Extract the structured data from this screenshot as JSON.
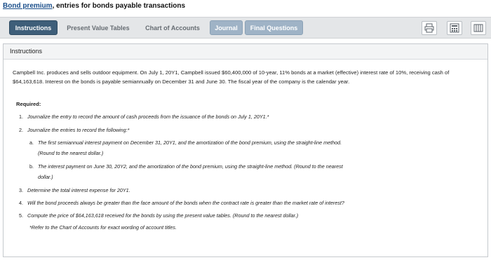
{
  "header": {
    "title_link": "Bond premium",
    "title_rest": ", entries for bonds payable transactions"
  },
  "tabs": [
    {
      "label": "Instructions"
    },
    {
      "label": "Present Value Tables"
    },
    {
      "label": "Chart of Accounts"
    },
    {
      "label": "Journal"
    },
    {
      "label": "Final Questions"
    }
  ],
  "toolbar": {
    "icons": [
      "printer-icon",
      "calculator-icon",
      "spreadsheet-icon"
    ]
  },
  "panel": {
    "heading": "Instructions",
    "intro": "Campbell Inc. produces and sells outdoor equipment. On July 1, 20Y1, Campbell issued $60,400,000 of 10-year, 11% bonds at a market (effective) interest rate of 10%, receiving cash of $64,163,618. Interest on the bonds is payable semiannually on December 31 and June 30. The fiscal year of the company is the calendar year.",
    "required_label": "Required:",
    "items": [
      {
        "num": "1.",
        "text": "Journalize the entry to record the amount of cash proceeds from the issuance of the bonds on July 1, 20Y1.*"
      },
      {
        "num": "2.",
        "text": "Journalize the entries to record the following:*"
      },
      {
        "num": "a.",
        "text": "The first semiannual interest payment on December 31, 20Y1, and the amortization of the bond premium, using the straight-line method."
      },
      {
        "num": "",
        "text": "(Round to the nearest dollar.)"
      },
      {
        "num": "b.",
        "text": "The interest payment on June 30, 20Y2, and the amortization of the bond premium, using the straight-line method. (Round to the nearest"
      },
      {
        "num": "",
        "text": "dollar.)"
      },
      {
        "num": "3.",
        "text": "Determine the total interest expense for 20Y1."
      },
      {
        "num": "4.",
        "text": "Will the bond proceeds always be greater than the face amount of the bonds when the contract rate is greater than the market rate of interest?"
      },
      {
        "num": "5.",
        "text": "Compute the price of $64,163,618 received for the bonds by using the present value tables. (Round to the nearest dollar.)"
      },
      {
        "num": "",
        "text": "*Refer to the Chart of Accounts for exact wording of account titles."
      }
    ]
  }
}
